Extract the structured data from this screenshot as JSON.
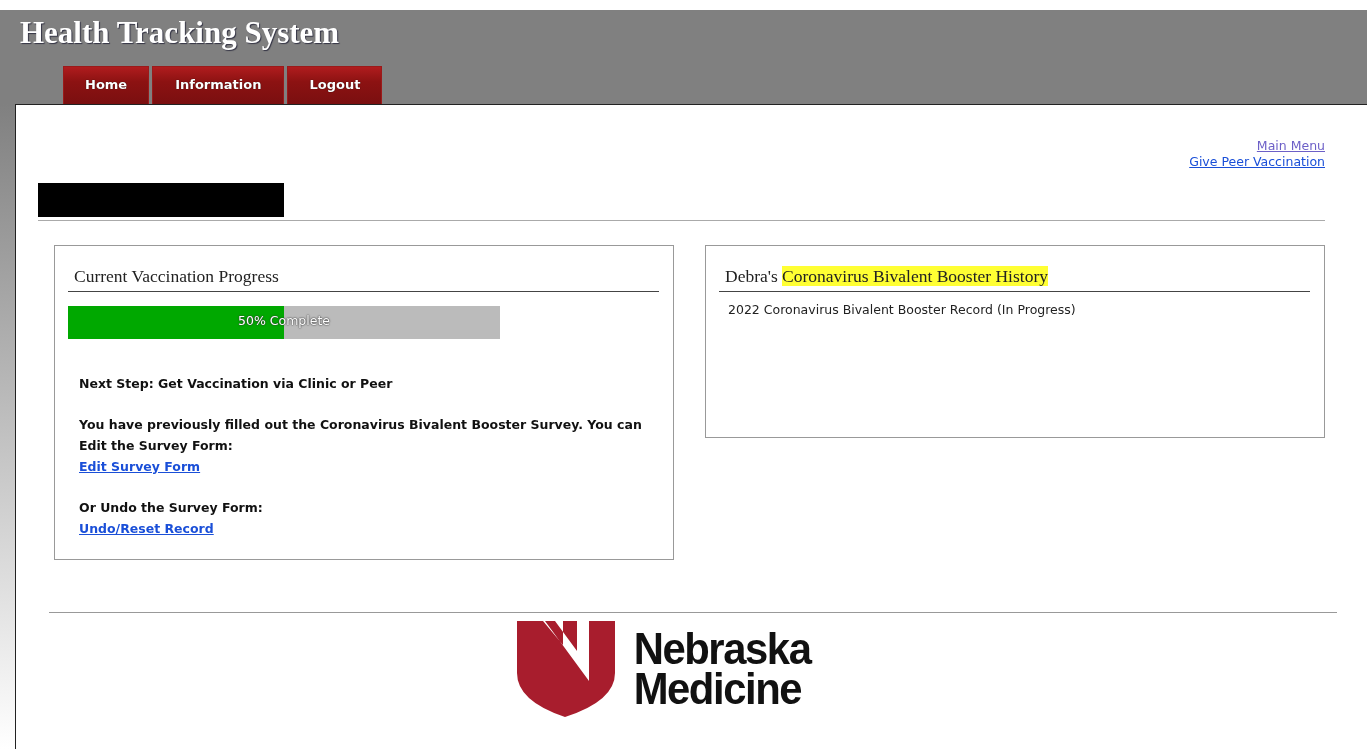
{
  "header": {
    "title": "Health Tracking System"
  },
  "nav_tabs": [
    {
      "label": "Home"
    },
    {
      "label": "Information"
    },
    {
      "label": "Logout"
    }
  ],
  "top_links": [
    {
      "label": "Main Menu",
      "visited": true
    },
    {
      "label": "Give Peer Vaccination",
      "visited": false
    }
  ],
  "progress_card": {
    "title": "Current Vaccination Progress",
    "level": 0.5,
    "progress_label": "50% Complete",
    "paragraphs": [
      {
        "text": "Next Step: Get Vaccination via Clinic or Peer"
      },
      {
        "text": "You have previously filled out the Coronavirus Bivalent Booster Survey. You can Edit the Survey Form:",
        "link": "Edit Survey Form"
      },
      {
        "text": "Or Undo the Survey Form:",
        "link": "Undo/Reset Record"
      }
    ]
  },
  "history_card": {
    "title_parts": [
      {
        "text": "Debra's ",
        "highlighted": false
      },
      {
        "text": "Coronavirus Bivalent Booster History",
        "highlighted": true
      }
    ],
    "records": [
      "2022 Coronavirus Bivalent Booster Record (In Progress)"
    ]
  },
  "footer": {
    "logo_lines": [
      "Nebraska",
      "Medicine"
    ]
  }
}
